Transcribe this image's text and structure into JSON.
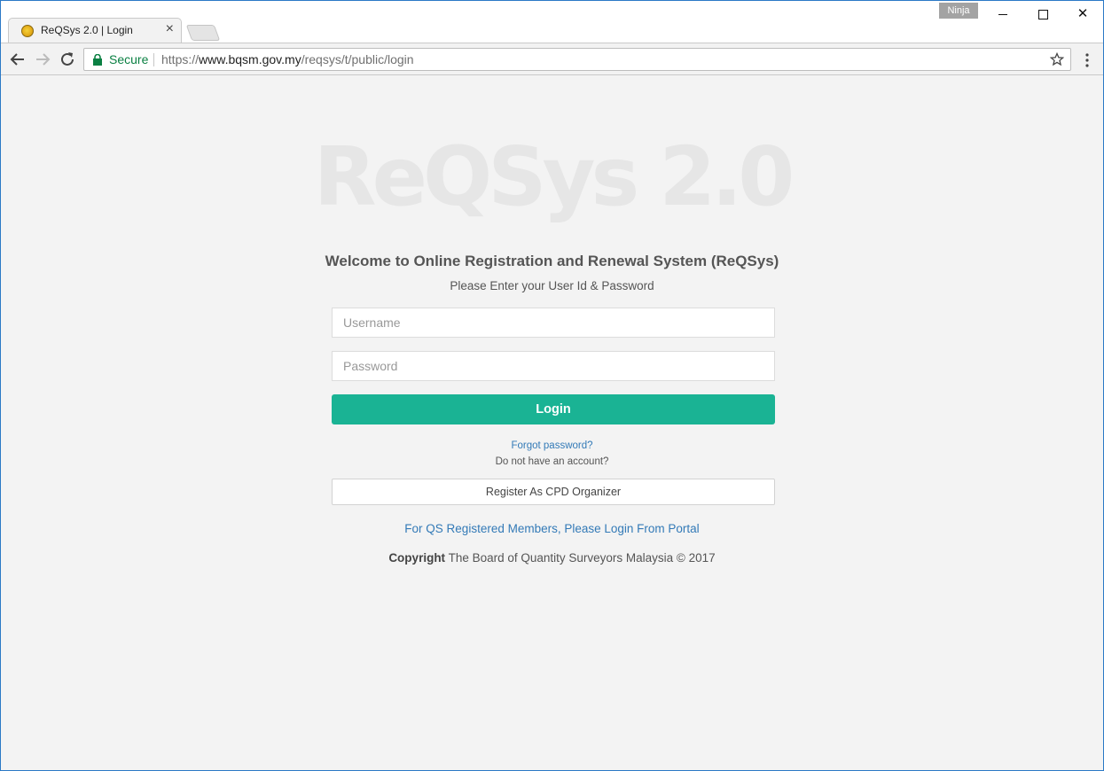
{
  "browser": {
    "tab": {
      "title": "ReQSys 2.0 | Login",
      "close_symbol": "×"
    },
    "profile_name": "Ninja",
    "window_buttons": {
      "close_symbol": "✕"
    },
    "address_bar": {
      "secure_label": "Secure",
      "url_scheme": "https://",
      "url_host": "www.bqsm.gov.my",
      "url_path": "/reqsys/t/public/login"
    }
  },
  "page": {
    "logo_text": "ReQSys 2.0",
    "welcome_heading": "Welcome to Online Registration and Renewal System (ReQSys)",
    "subtitle": "Please Enter your User Id & Password",
    "username_placeholder": "Username",
    "password_placeholder": "Password",
    "login_label": "Login",
    "forgot_password": "Forgot password?",
    "no_account": "Do not have an account?",
    "register_label": "Register As CPD Organizer",
    "portal_link": "For QS Registered Members, Please Login From Portal",
    "copyright_bold": "Copyright",
    "copyright_text": " The Board of Quantity Surveyors Malaysia © 2017"
  },
  "colors": {
    "accent_button": "#1ab394",
    "link": "#337ab7",
    "secure_green": "#0b8043",
    "window_border": "#2b79c6"
  }
}
